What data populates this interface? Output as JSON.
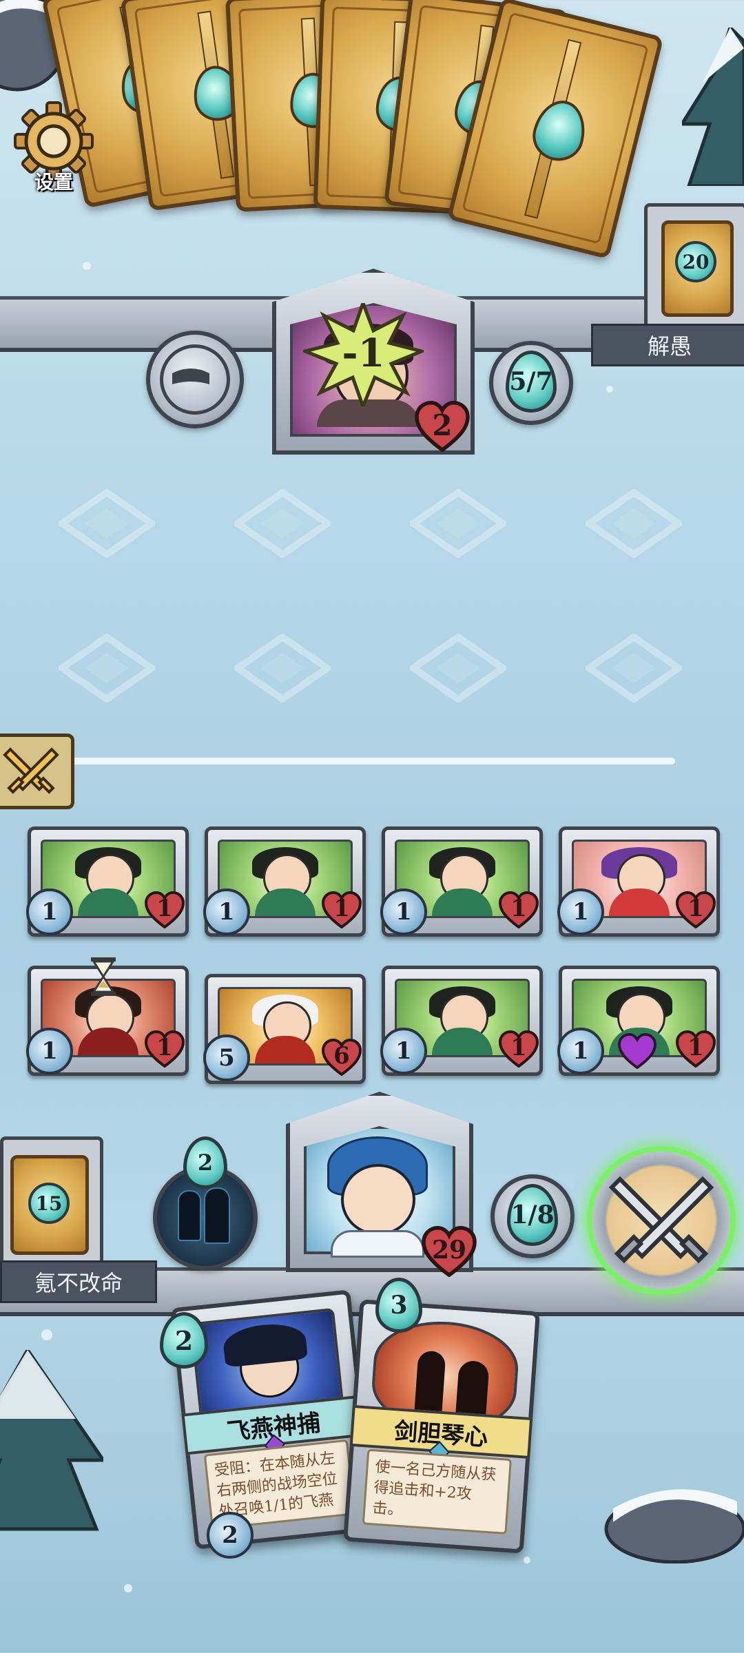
{
  "settings": {
    "label": "设置"
  },
  "opponent": {
    "name": "解愚",
    "health": "2",
    "damage": "-1",
    "mana": "5/7",
    "deck_count": "20",
    "hand_count": 6
  },
  "player": {
    "name": "氪不改命",
    "health": "29",
    "mana": "1/8",
    "deck_count": "15",
    "hero_power_cost": "2"
  },
  "board": {
    "row1": [
      {
        "attack": "1",
        "health": "1",
        "art": "green"
      },
      {
        "attack": "1",
        "health": "1",
        "art": "green"
      },
      {
        "attack": "1",
        "health": "1",
        "art": "green"
      },
      {
        "attack": "1",
        "health": "1",
        "art": "pink"
      }
    ],
    "row2": [
      {
        "attack": "1",
        "health": "1",
        "art": "red"
      },
      {
        "attack": "5",
        "health": "6",
        "art": "gold"
      },
      {
        "attack": "1",
        "health": "1",
        "art": "green"
      },
      {
        "attack": "1",
        "health": "1",
        "art": "green"
      }
    ]
  },
  "hand": [
    {
      "cost": "2",
      "name": "飞燕神捕",
      "text": "受阻：在本随从左右两侧的战场空位处召唤1/1的飞燕之影",
      "attack": "2"
    },
    {
      "cost": "3",
      "name": "剑胆琴心",
      "text": "使一名己方随从获得追击和+2攻击。"
    }
  ],
  "colors": {
    "mana": "#5fcac2",
    "health": "#c9474a",
    "glow": "#7df06a"
  }
}
